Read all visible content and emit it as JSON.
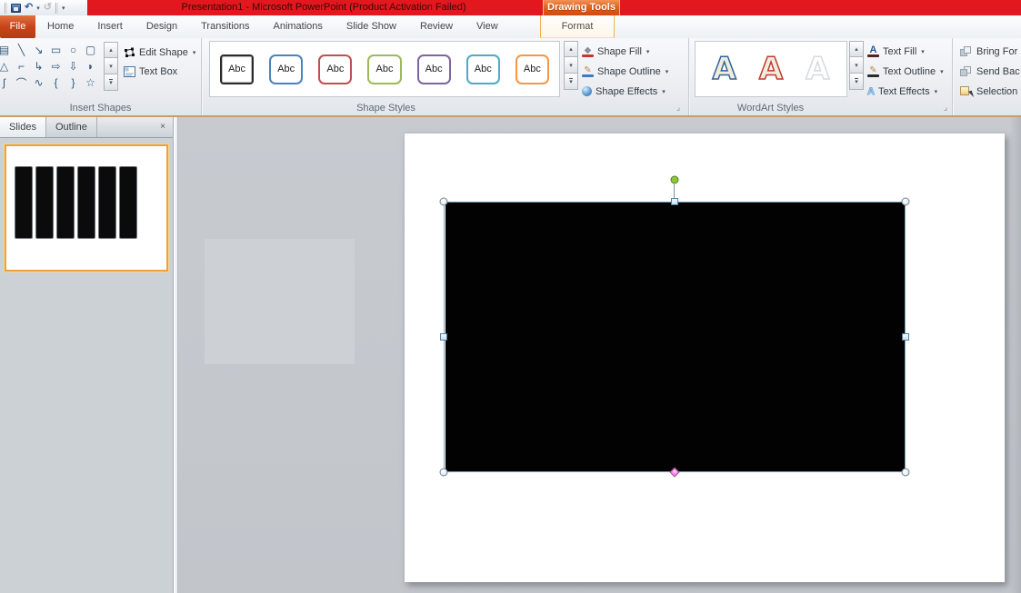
{
  "app": {
    "title": "Presentation1 - Microsoft PowerPoint (Product Activation Failed)",
    "contextual_tool_tab": "Drawing Tools"
  },
  "colors": {
    "titlebar_red": "#e2181e",
    "rotate_handle": "#8cc63f",
    "adjust_handle": "#ef79e2",
    "selection_outline": "#7fa1bd",
    "shape_fill": "#020202"
  },
  "tabs": {
    "file": "File",
    "items": [
      "Home",
      "Insert",
      "Design",
      "Transitions",
      "Animations",
      "Slide Show",
      "Review",
      "View"
    ],
    "contextual": "Format"
  },
  "glyphs": {
    "caret": "▾",
    "scroll_up": "▴",
    "scroll_down": "▾",
    "more": "▾",
    "undo": "↶",
    "redo": "↺",
    "close": "×",
    "launcher": "⌟",
    "text_fill_A": "A",
    "text_effects_A": "A"
  },
  "ribbon": {
    "insert_shapes": {
      "label": "Insert Shapes",
      "edit_shape": "Edit Shape",
      "text_box": "Text Box",
      "gallery": [
        "▤",
        "╲",
        "↘",
        "▭",
        "○",
        "▢",
        "△",
        "⌐",
        "↳",
        "⇨",
        "⇩",
        "◗",
        "ʃ",
        "⌒",
        "∿",
        "{",
        "}",
        "☆"
      ]
    },
    "shape_styles": {
      "label": "Shape Styles",
      "preview_label": "Abc",
      "colors": [
        "#2b2b2b",
        "#4f81bd",
        "#c0504d",
        "#9bbb59",
        "#8064a2",
        "#4bacc6",
        "#f79646"
      ],
      "buttons": [
        {
          "label": "Shape Fill",
          "bar": "#c0392b"
        },
        {
          "label": "Shape Outline",
          "bar": "#3b7dbd"
        },
        {
          "label": "Shape Effects",
          "bar": ""
        }
      ]
    },
    "wordart_styles": {
      "label": "WordArt Styles",
      "samples": [
        {
          "char": "A",
          "fill": "#f2ecdf",
          "stroke": "#31659c"
        },
        {
          "char": "A",
          "fill": "#f2ecdf",
          "stroke": "#c03b2b"
        },
        {
          "char": "A",
          "fill": "#ffffff",
          "stroke": "#d6dae0"
        }
      ],
      "buttons": [
        {
          "label": "Text Fill",
          "bar": "#5a1f1f"
        },
        {
          "label": "Text Outline",
          "bar": "#2b2b2b"
        },
        {
          "label": "Text Effects",
          "bar": ""
        }
      ]
    },
    "arrange": {
      "items": [
        "Bring For",
        "Send Bac",
        "Selection"
      ]
    }
  },
  "left_panel": {
    "tabs": [
      "Slides",
      "Outline"
    ]
  }
}
